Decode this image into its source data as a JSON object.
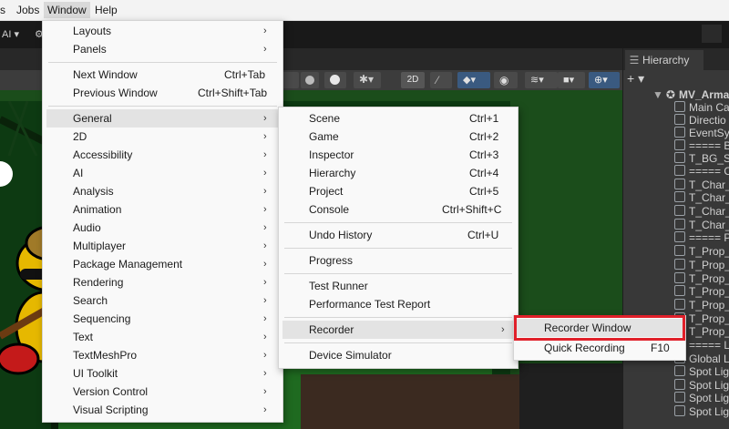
{
  "menubar": {
    "items": [
      {
        "label": "s"
      },
      {
        "label": "Jobs"
      },
      {
        "label": "Window"
      },
      {
        "label": "Help"
      }
    ]
  },
  "toolbar": {
    "ai_label": "AI",
    "twod_label": "2D"
  },
  "hierarchy": {
    "tab_label": "Hierarchy",
    "add_label": "+",
    "rows": [
      "MV_Armad",
      "Main Ca",
      "Directio",
      "EventSys",
      "===== B",
      "T_BG_Sta",
      "===== C",
      "T_Char_C",
      "T_Char_C",
      "T_Char_C",
      "T_Char_S",
      "===== P",
      "T_Prop_A",
      "T_Prop_A",
      "T_Prop_A",
      "T_Prop_A",
      "T_Prop_D",
      "T_Prop_M",
      "T_Prop_A",
      "===== Li",
      "Global Li",
      "Spot Ligh",
      "Spot Ligh",
      "Spot Ligh",
      "Spot Ligh"
    ]
  },
  "window_menu": {
    "top": [
      {
        "label": "Layouts",
        "submenu": true
      },
      {
        "label": "Panels",
        "submenu": true
      }
    ],
    "nav": [
      {
        "label": "Next Window",
        "shortcut": "Ctrl+Tab"
      },
      {
        "label": "Previous Window",
        "shortcut": "Ctrl+Shift+Tab"
      }
    ],
    "categories": [
      "General",
      "2D",
      "Accessibility",
      "AI",
      "Analysis",
      "Animation",
      "Audio",
      "Multiplayer",
      "Package Management",
      "Rendering",
      "Search",
      "Sequencing",
      "Text",
      "TextMeshPro",
      "UI Toolkit",
      "Version Control",
      "Visual Scripting"
    ]
  },
  "general_menu": {
    "group1": [
      {
        "label": "Scene",
        "shortcut": "Ctrl+1"
      },
      {
        "label": "Game",
        "shortcut": "Ctrl+2"
      },
      {
        "label": "Inspector",
        "shortcut": "Ctrl+3"
      },
      {
        "label": "Hierarchy",
        "shortcut": "Ctrl+4"
      },
      {
        "label": "Project",
        "shortcut": "Ctrl+5"
      },
      {
        "label": "Console",
        "shortcut": "Ctrl+Shift+C"
      }
    ],
    "group2": [
      {
        "label": "Undo History",
        "shortcut": "Ctrl+U"
      }
    ],
    "group3": [
      {
        "label": "Progress"
      }
    ],
    "group4": [
      {
        "label": "Test Runner"
      },
      {
        "label": "Performance Test Report"
      }
    ],
    "group5": [
      {
        "label": "Recorder"
      }
    ],
    "group6": [
      {
        "label": "Device Simulator"
      }
    ]
  },
  "recorder_menu": {
    "items": [
      {
        "label": "Recorder Window",
        "shortcut": ""
      },
      {
        "label": "Quick Recording",
        "shortcut": "F10"
      }
    ]
  },
  "colors": {
    "highlight_box": "#e0202a",
    "menu_bg": "#f9f9f9",
    "editor_bg": "#383838"
  }
}
